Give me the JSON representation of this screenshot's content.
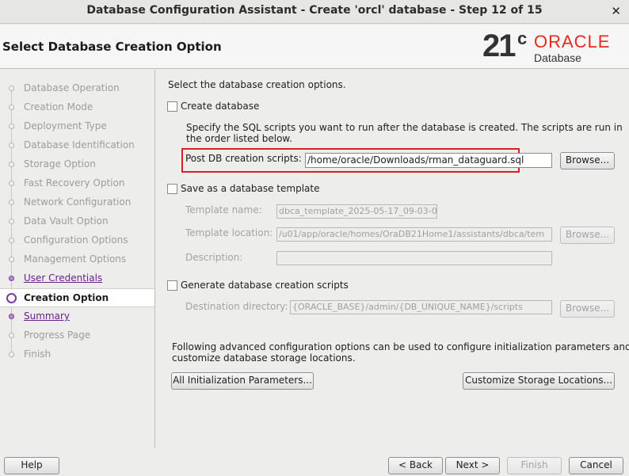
{
  "window": {
    "title": "Database Configuration Assistant - Create 'orcl' database - Step 12 of 15",
    "close_glyph": "✕"
  },
  "header": {
    "page_title": "Select Database Creation Option",
    "logo": {
      "version": "21",
      "version_suffix": "c",
      "brand": "ORACLE",
      "product": "Database"
    }
  },
  "steps": [
    {
      "label": "Database Operation",
      "state": "disabled"
    },
    {
      "label": "Creation Mode",
      "state": "disabled"
    },
    {
      "label": "Deployment Type",
      "state": "disabled"
    },
    {
      "label": "Database Identification",
      "state": "disabled"
    },
    {
      "label": "Storage Option",
      "state": "disabled"
    },
    {
      "label": "Fast Recovery Option",
      "state": "disabled"
    },
    {
      "label": "Network Configuration",
      "state": "disabled"
    },
    {
      "label": "Data Vault Option",
      "state": "disabled"
    },
    {
      "label": "Configuration Options",
      "state": "disabled"
    },
    {
      "label": "Management Options",
      "state": "disabled"
    },
    {
      "label": "User Credentials",
      "state": "link"
    },
    {
      "label": "Creation Option",
      "state": "current"
    },
    {
      "label": "Summary",
      "state": "link"
    },
    {
      "label": "Progress Page",
      "state": "disabled"
    },
    {
      "label": "Finish",
      "state": "disabled"
    }
  ],
  "content": {
    "intro": "Select the database creation options.",
    "create_db": {
      "label": "Create database",
      "checked": false,
      "desc_line1": "Specify the SQL scripts you want to run after the database is created. The scripts are run in",
      "desc_line2": "the order listed below.",
      "scripts_label": "Post DB creation scripts:",
      "scripts_value": "/home/oracle/Downloads/rman_dataguard.sql",
      "browse": "Browse..."
    },
    "template": {
      "label": "Save as a database template",
      "checked": false,
      "name_label": "Template name:",
      "name_value": "dbca_template_2025-05-17_09-03-0",
      "location_label": "Template location:",
      "location_value": "/u01/app/oracle/homes/OraDB21Home1/assistants/dbca/tem",
      "location_browse": "Browse...",
      "description_label": "Description:",
      "description_value": ""
    },
    "scripts": {
      "label": "Generate database creation scripts",
      "checked": false,
      "dest_label": "Destination directory:",
      "dest_value": "{ORACLE_BASE}/admin/{DB_UNIQUE_NAME}/scripts",
      "browse": "Browse..."
    },
    "advanced_line1": "Following advanced configuration options can be used to configure initialization parameters and",
    "advanced_line2": "customize database storage locations.",
    "init_params_button": "All Initialization Parameters...",
    "storage_button": "Customize Storage Locations..."
  },
  "footer": {
    "help": "Help",
    "back": "< Back",
    "next": "Next >",
    "finish": "Finish",
    "cancel": "Cancel"
  },
  "colors": {
    "accent_purple": "#7a3d99",
    "highlight_red": "#d9201e",
    "oracle_red": "#e32b1e"
  }
}
